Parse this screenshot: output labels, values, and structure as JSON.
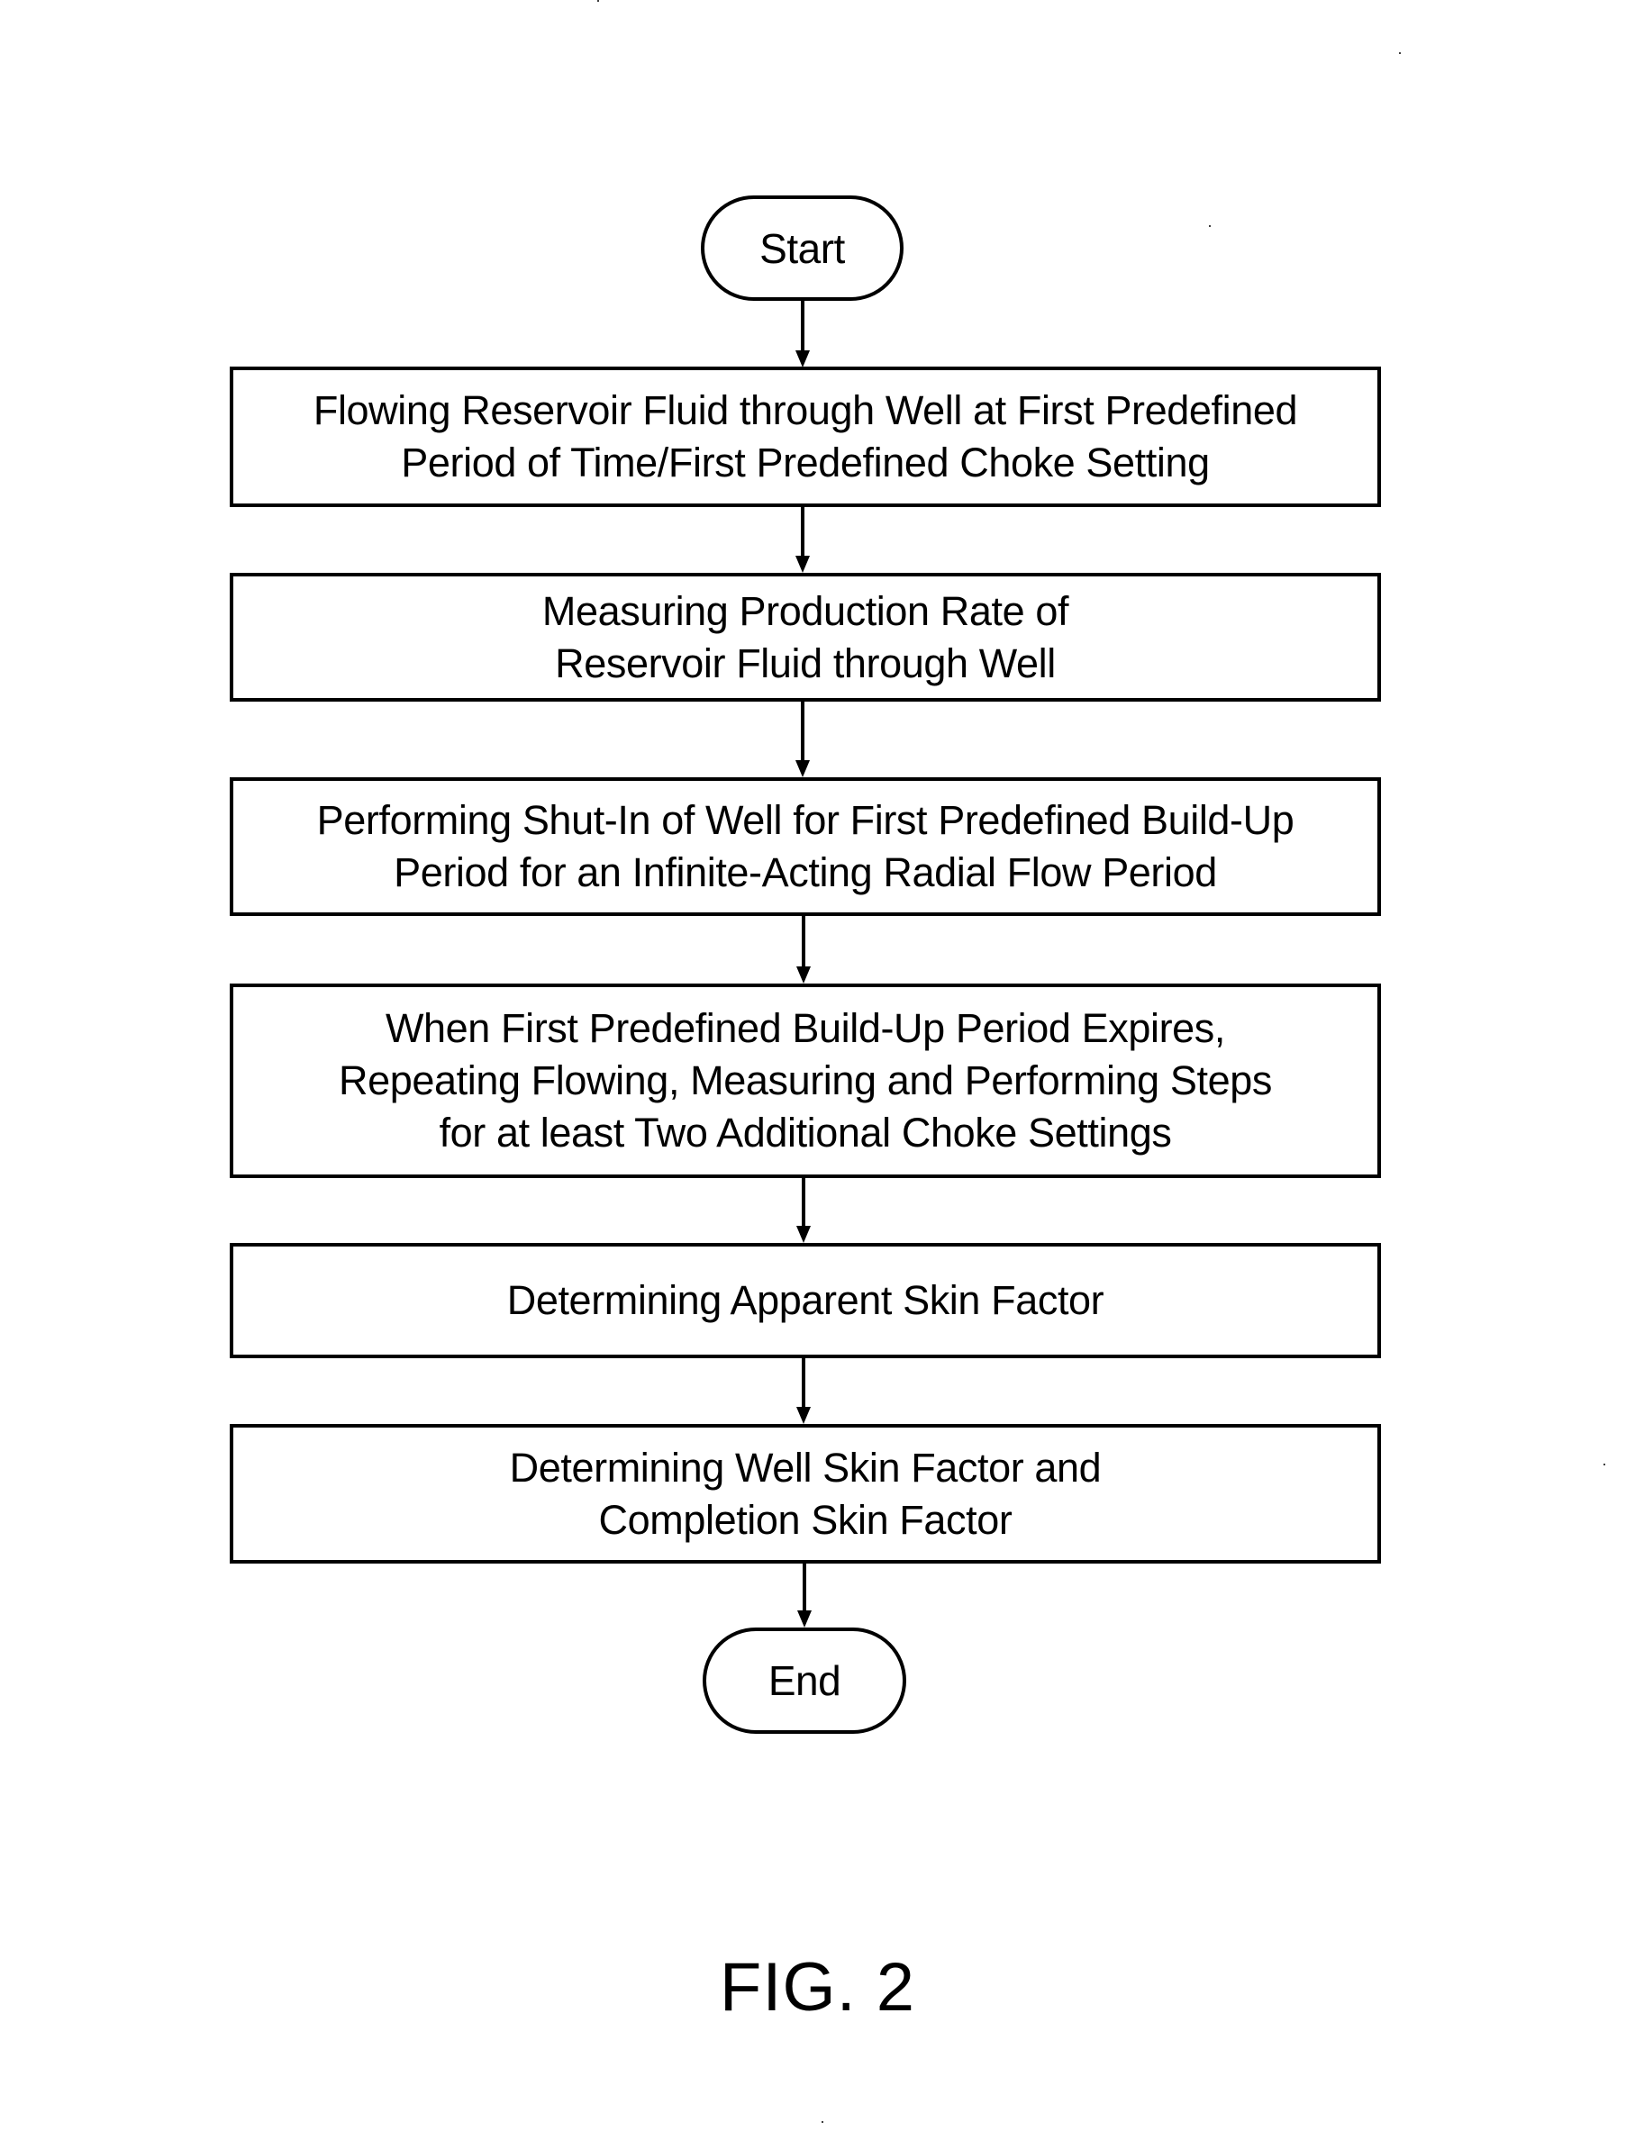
{
  "diagram": {
    "type": "flowchart",
    "start_label": "Start",
    "end_label": "End",
    "steps": [
      {
        "lines": [
          "Flowing Reservoir Fluid through Well at First Predefined",
          "Period of Time/First Predefined Choke Setting"
        ]
      },
      {
        "lines": [
          "Measuring Production Rate of",
          "Reservoir Fluid through Well"
        ]
      },
      {
        "lines": [
          "Performing Shut-In of Well for First Predefined Build-Up",
          "Period for an Infinite-Acting Radial Flow Period"
        ]
      },
      {
        "lines": [
          "When First Predefined Build-Up Period Expires,",
          "Repeating Flowing, Measuring and Performing Steps",
          "for at least Two Additional Choke Settings"
        ]
      },
      {
        "lines": [
          "Determining Apparent Skin Factor"
        ]
      },
      {
        "lines": [
          "Determining Well Skin Factor and",
          "Completion Skin Factor"
        ]
      }
    ],
    "edges": [
      [
        "start",
        "step-1"
      ],
      [
        "step-1",
        "step-2"
      ],
      [
        "step-2",
        "step-3"
      ],
      [
        "step-3",
        "step-4"
      ],
      [
        "step-4",
        "step-5"
      ],
      [
        "step-5",
        "step-6"
      ],
      [
        "step-6",
        "end"
      ]
    ]
  },
  "figure_label": "FIG. 2",
  "colors": {
    "ink": "#000000",
    "paper": "#ffffff"
  }
}
